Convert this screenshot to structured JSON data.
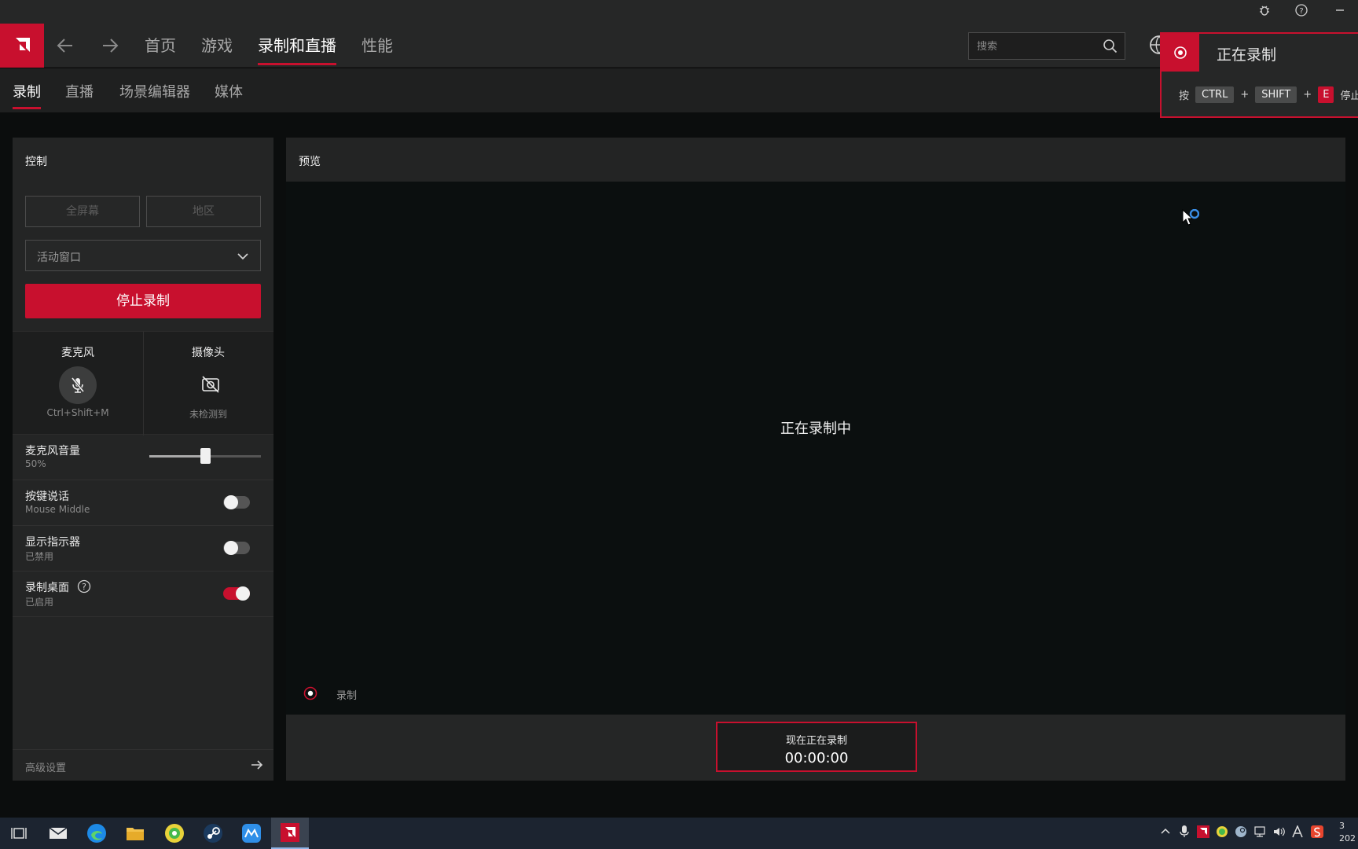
{
  "app": {
    "name": "AMD Software"
  },
  "titlebar": {
    "icons": [
      "bug-icon",
      "help-icon",
      "minimize-icon"
    ]
  },
  "nav": {
    "items": [
      "首页",
      "游戏",
      "录制和直播",
      "性能"
    ],
    "active": "录制和直播"
  },
  "search": {
    "placeholder": "搜索"
  },
  "subnav": {
    "items": [
      "录制",
      "直播",
      "场景编辑器",
      "媒体"
    ],
    "active": "录制"
  },
  "control": {
    "title": "控制",
    "fullscreen_label": "全屏幕",
    "region_label": "地区",
    "capture_source": "活动窗口",
    "stop_label": "停止录制",
    "mic": {
      "title": "麦克风",
      "shortcut": "Ctrl+Shift+M"
    },
    "camera": {
      "title": "摄像头",
      "status": "未检测到"
    },
    "mic_volume": {
      "label": "麦克风音量",
      "value": "50%",
      "level": 0.5
    },
    "push_to_talk": {
      "label": "按键说话",
      "sub": "Mouse Middle",
      "enabled": false
    },
    "show_indicator": {
      "label": "显示指示器",
      "sub": "已禁用",
      "enabled": false
    },
    "record_desktop": {
      "label": "录制桌面",
      "sub": "已启用",
      "enabled": true
    },
    "advanced_label": "高级设置"
  },
  "preview": {
    "title": "预览",
    "center_text": "正在录制中",
    "indicator_label": "录制",
    "timer_label": "现在正在录制",
    "timer_value": "00:00:00"
  },
  "toast": {
    "title": "正在录制",
    "press": "按",
    "key1": "CTRL",
    "plus": "+",
    "key2": "SHIFT",
    "key3": "E",
    "action": "停止录"
  },
  "taskbar": {
    "apps": [
      "task-view-icon",
      "mail-icon",
      "edge-icon",
      "file-explorer-icon",
      "game-app-icon",
      "steam-icon",
      "maxthon-icon",
      "amd-icon"
    ],
    "clock_line1": "3",
    "clock_line2": "202"
  },
  "colors": {
    "accent": "#c8102e",
    "background": "#0b0d0d",
    "panel": "#242525"
  }
}
